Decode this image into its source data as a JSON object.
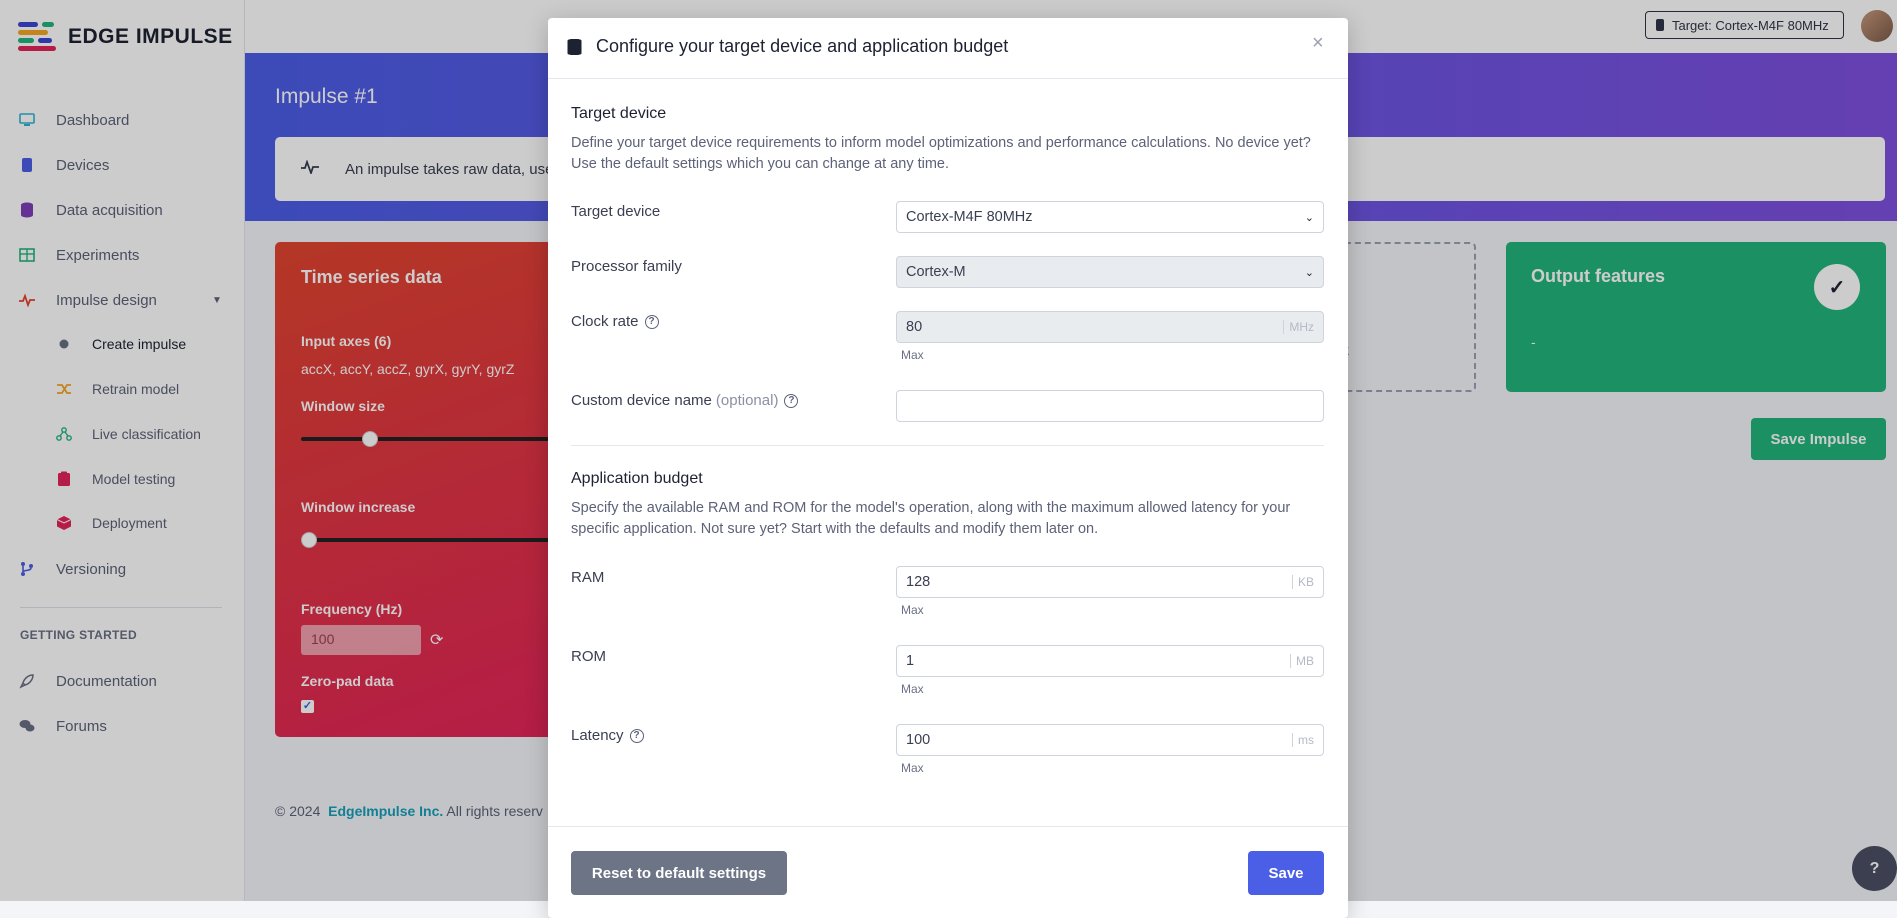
{
  "brand": {
    "name": "EDGE IMPULSE"
  },
  "topbar": {
    "target_button": "Target: Cortex-M4F 80MHz"
  },
  "sidebar": {
    "items": [
      {
        "label": "Dashboard",
        "icon": "monitor-icon"
      },
      {
        "label": "Devices",
        "icon": "chip-icon"
      },
      {
        "label": "Data acquisition",
        "icon": "database-icon"
      },
      {
        "label": "Experiments",
        "icon": "table-icon"
      },
      {
        "label": "Impulse design",
        "icon": "pulse-icon"
      }
    ],
    "sub_items": [
      {
        "label": "Create impulse",
        "icon": "dot-icon"
      },
      {
        "label": "Retrain model",
        "icon": "shuffle-icon"
      },
      {
        "label": "Live classification",
        "icon": "nodes-icon"
      },
      {
        "label": "Model testing",
        "icon": "clipboard-icon"
      },
      {
        "label": "Deployment",
        "icon": "cube-icon"
      }
    ],
    "versioning": "Versioning",
    "section_title": "GETTING STARTED",
    "getting_started": [
      {
        "label": "Documentation",
        "icon": "rocket-icon"
      },
      {
        "label": "Forums",
        "icon": "chat-icon"
      }
    ]
  },
  "page": {
    "title": "Impulse #1",
    "info_text": "An impulse takes raw data, use",
    "ts_card": {
      "title": "Time series data",
      "input_axes_label": "Input axes (6)",
      "input_axes_value": "accX, accY, accZ, gyrX, gyrY, gyrZ",
      "window_size_label": "Window size",
      "window_increase_label": "Window increase",
      "frequency_label": "Frequency (Hz)",
      "frequency_value": "100",
      "zero_pad_label": "Zero-pad data"
    },
    "learn_card_partial": "ck",
    "output_card": {
      "title": "Output features",
      "value": "-"
    },
    "save_impulse": "Save Impulse",
    "footer": {
      "prefix": "© 2024",
      "company": "EdgeImpulse Inc.",
      "suffix": "All rights reserv"
    }
  },
  "modal": {
    "title": "Configure your target device and application budget",
    "target_section": {
      "title": "Target device",
      "description": "Define your target device requirements to inform model optimizations and performance calculations. No device yet? Use the default settings which you can change at any time."
    },
    "fields": {
      "target_device": {
        "label": "Target device",
        "value": "Cortex-M4F 80MHz"
      },
      "processor_family": {
        "label": "Processor family",
        "value": "Cortex-M"
      },
      "clock_rate": {
        "label": "Clock rate",
        "value": "80",
        "unit": "MHz",
        "hint": "Max"
      },
      "custom_name": {
        "label": "Custom device name",
        "optional": "(optional)",
        "value": ""
      }
    },
    "budget_section": {
      "title": "Application budget",
      "description": "Specify the available RAM and ROM for the model's operation, along with the maximum allowed latency for your specific application. Not sure yet? Start with the defaults and modify them later on."
    },
    "budget": {
      "ram": {
        "label": "RAM",
        "value": "128",
        "unit": "KB",
        "hint": "Max"
      },
      "rom": {
        "label": "ROM",
        "value": "1",
        "unit": "MB",
        "hint": "Max"
      },
      "latency": {
        "label": "Latency",
        "value": "100",
        "unit": "ms",
        "hint": "Max"
      }
    },
    "reset_label": "Reset to default settings",
    "save_label": "Save"
  },
  "colors": {
    "accent": "#4b5ee6",
    "hero_gradient_end": "#7e50df",
    "time_series_card": "#e2345a",
    "output_card": "#22b47b"
  }
}
